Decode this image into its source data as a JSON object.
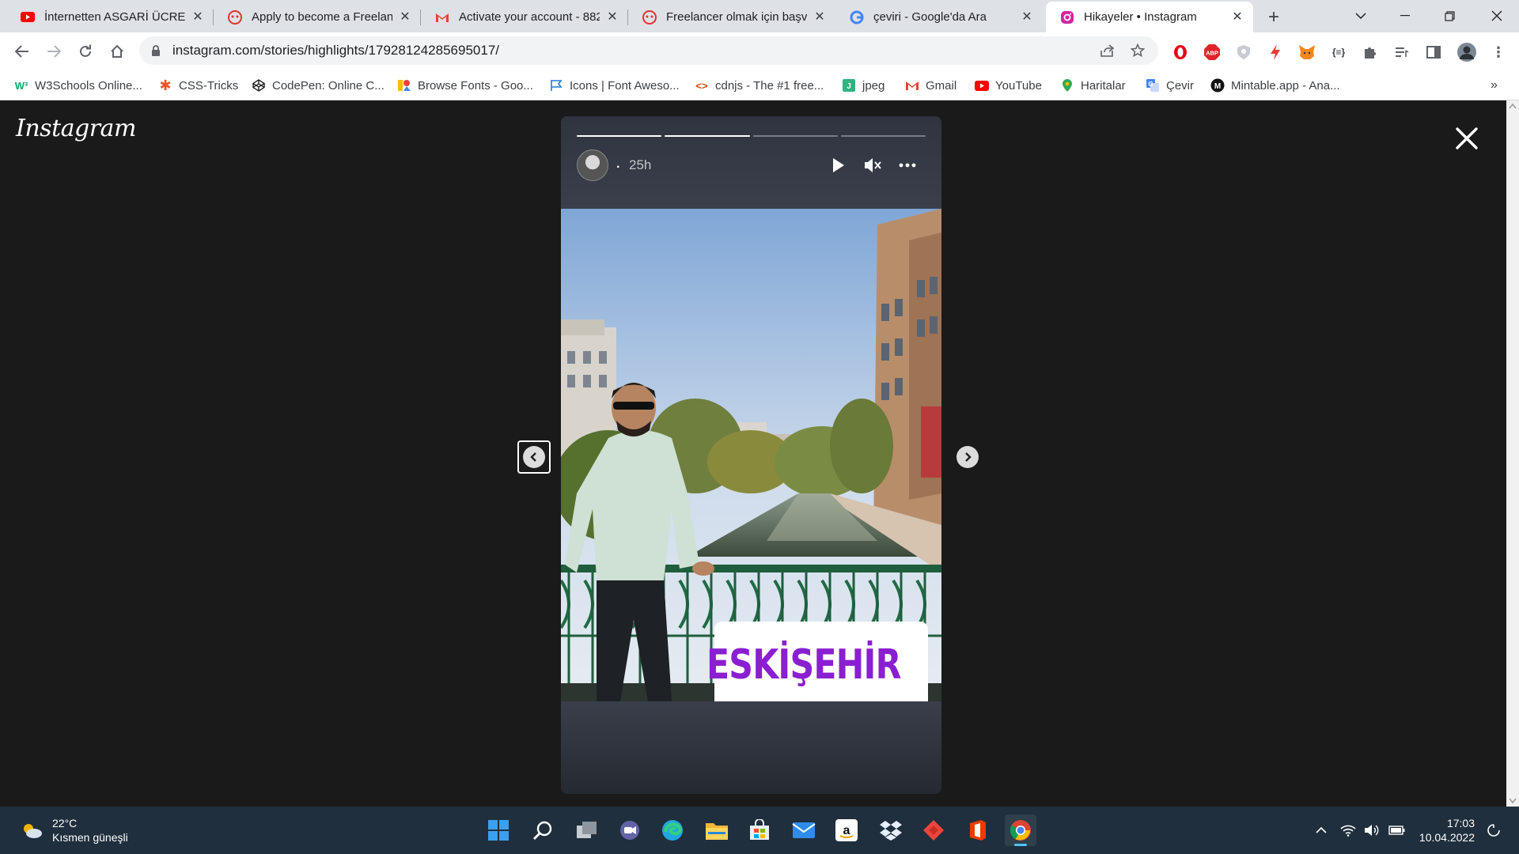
{
  "browser": {
    "tabs": [
      {
        "title": "İnternetten ASGARİ ÜCRET",
        "favicon": "youtube-icon",
        "active": false
      },
      {
        "title": "Apply to become a Freelancer",
        "favicon": "freelancer-icon",
        "active": false
      },
      {
        "title": "Activate your account - 882",
        "favicon": "gmail-icon",
        "active": false
      },
      {
        "title": "Freelancer olmak için başvur",
        "favicon": "freelancer-icon",
        "active": false
      },
      {
        "title": "çeviri - Google'da Ara",
        "favicon": "google-icon",
        "active": false
      },
      {
        "title": "Hikayeler • Instagram",
        "favicon": "instagram-icon",
        "active": true
      }
    ],
    "new_tab_label": "+",
    "url": "instagram.com/stories/highlights/17928124285695017/",
    "bookmarks": [
      {
        "label": "W3Schools Online...",
        "icon": "w3schools-icon",
        "color": "#04aa6d"
      },
      {
        "label": "CSS-Tricks",
        "icon": "css-tricks-icon",
        "color": "#e8562a"
      },
      {
        "label": "CodePen: Online C...",
        "icon": "codepen-icon",
        "color": "#111111"
      },
      {
        "label": "Browse Fonts - Goo...",
        "icon": "google-fonts-icon",
        "color": "#4285f4"
      },
      {
        "label": "Icons | Font Aweso...",
        "icon": "font-awesome-icon",
        "color": "#1c7ed6"
      },
      {
        "label": "cdnjs - The #1 free...",
        "icon": "cdnjs-icon",
        "color": "#d9480f"
      },
      {
        "label": "jpeg",
        "icon": "jpeg-icon",
        "color": "#2fb380"
      },
      {
        "label": "Gmail",
        "icon": "gmail-icon",
        "color": "#ea4335"
      },
      {
        "label": "YouTube",
        "icon": "youtube-icon",
        "color": "#ff0000"
      },
      {
        "label": "Haritalar",
        "icon": "maps-icon",
        "color": "#34a853"
      },
      {
        "label": "Çevir",
        "icon": "translate-icon",
        "color": "#4285f4"
      },
      {
        "label": "Mintable.app - Ana...",
        "icon": "mintable-icon",
        "color": "#111111"
      }
    ],
    "bookmarks_overflow": "»"
  },
  "story": {
    "logo_text": "Instagram",
    "username": ".",
    "time_ago": "25h",
    "segments_total": 4,
    "segments_done": 2,
    "sticker_text": "ESKİŞEHİR",
    "colors": {
      "sticker_text": "#8a1fd1",
      "sticker_pin": "#a21caf"
    }
  },
  "taskbar": {
    "weather_temp": "22°C",
    "weather_desc": "Kısmen güneşli",
    "time": "17:03",
    "date": "10.04.2022",
    "apps": [
      "windows-start-icon",
      "search-icon",
      "task-view-icon",
      "chat-icon",
      "edge-icon",
      "file-explorer-icon",
      "store-icon",
      "mail-icon",
      "amazon-icon",
      "dropbox-icon",
      "anydesk-icon",
      "office-icon",
      "chrome-icon"
    ]
  }
}
